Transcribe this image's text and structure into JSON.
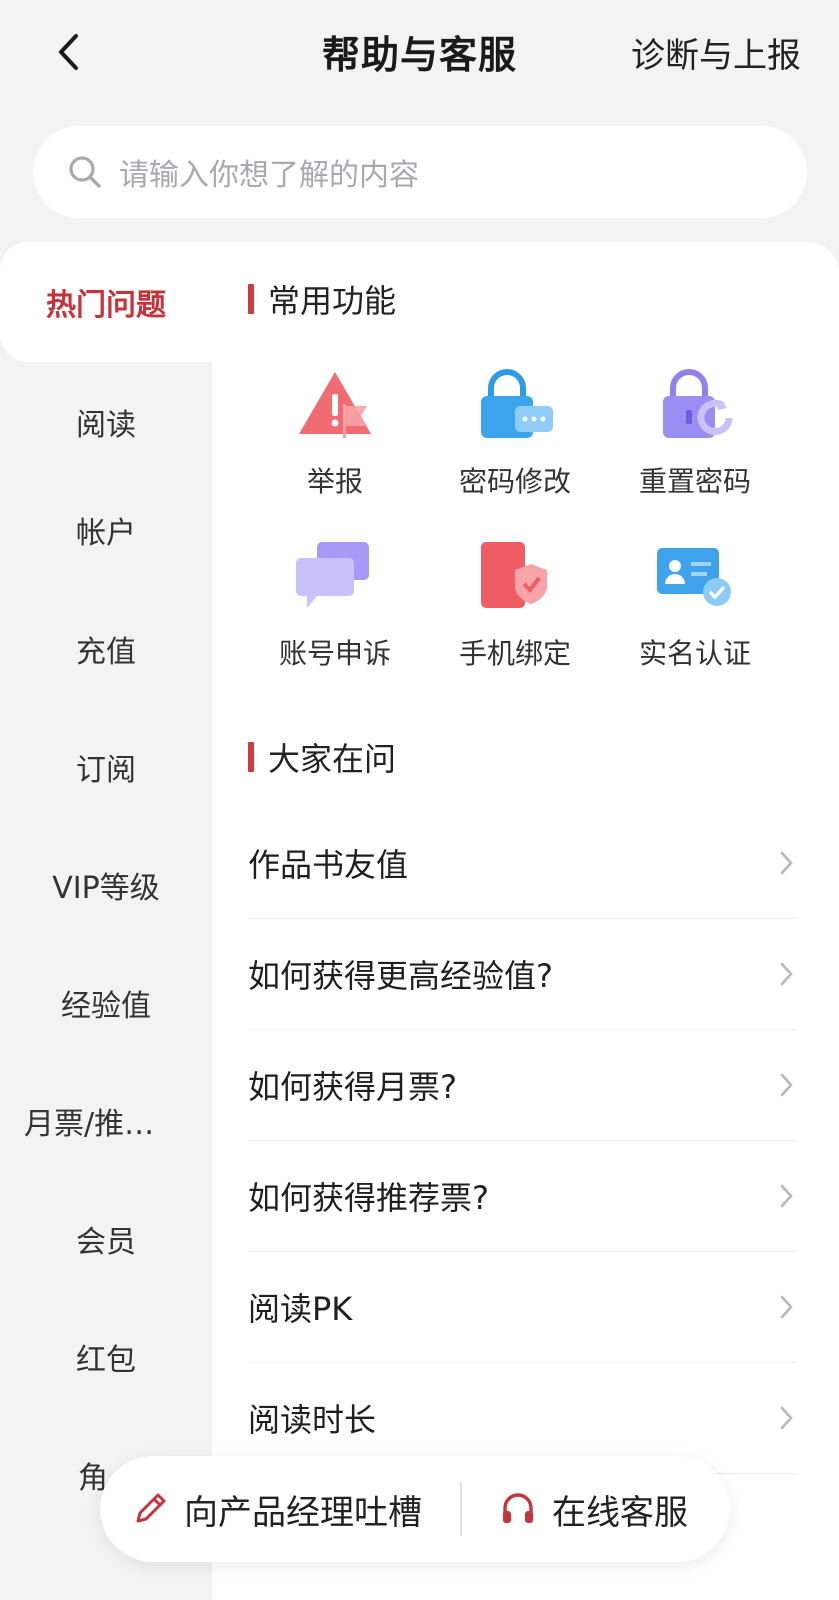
{
  "header": {
    "title": "帮助与客服",
    "right_link": "诊断与上报"
  },
  "search": {
    "placeholder": "请输入你想了解的内容"
  },
  "sidebar": {
    "items": [
      {
        "label": "热门问题",
        "active": true
      },
      {
        "label": "阅读"
      },
      {
        "label": "帐户"
      },
      {
        "label": "充值"
      },
      {
        "label": "订阅"
      },
      {
        "label": "VIP等级"
      },
      {
        "label": "经验值"
      },
      {
        "label": "月票/推…"
      },
      {
        "label": "会员"
      },
      {
        "label": "红包"
      },
      {
        "label": "角"
      }
    ]
  },
  "common": {
    "title": "常用功能",
    "features": [
      {
        "label": "举报",
        "icon": "report-icon"
      },
      {
        "label": "密码修改",
        "icon": "password-change-icon"
      },
      {
        "label": "重置密码",
        "icon": "password-reset-icon"
      },
      {
        "label": "账号申诉",
        "icon": "appeal-icon"
      },
      {
        "label": "手机绑定",
        "icon": "phone-bind-icon"
      },
      {
        "label": "实名认证",
        "icon": "real-name-icon"
      }
    ]
  },
  "faq": {
    "title": "大家在问",
    "items": [
      "作品书友值",
      "如何获得更高经验值?",
      "如何获得月票?",
      "如何获得推荐票?",
      "阅读PK",
      "阅读时长"
    ]
  },
  "bottom": {
    "feedback_label": "向产品经理吐槽",
    "service_label": "在线客服"
  },
  "colors": {
    "accent": "#c8323a",
    "background": "#f3f3f4"
  }
}
